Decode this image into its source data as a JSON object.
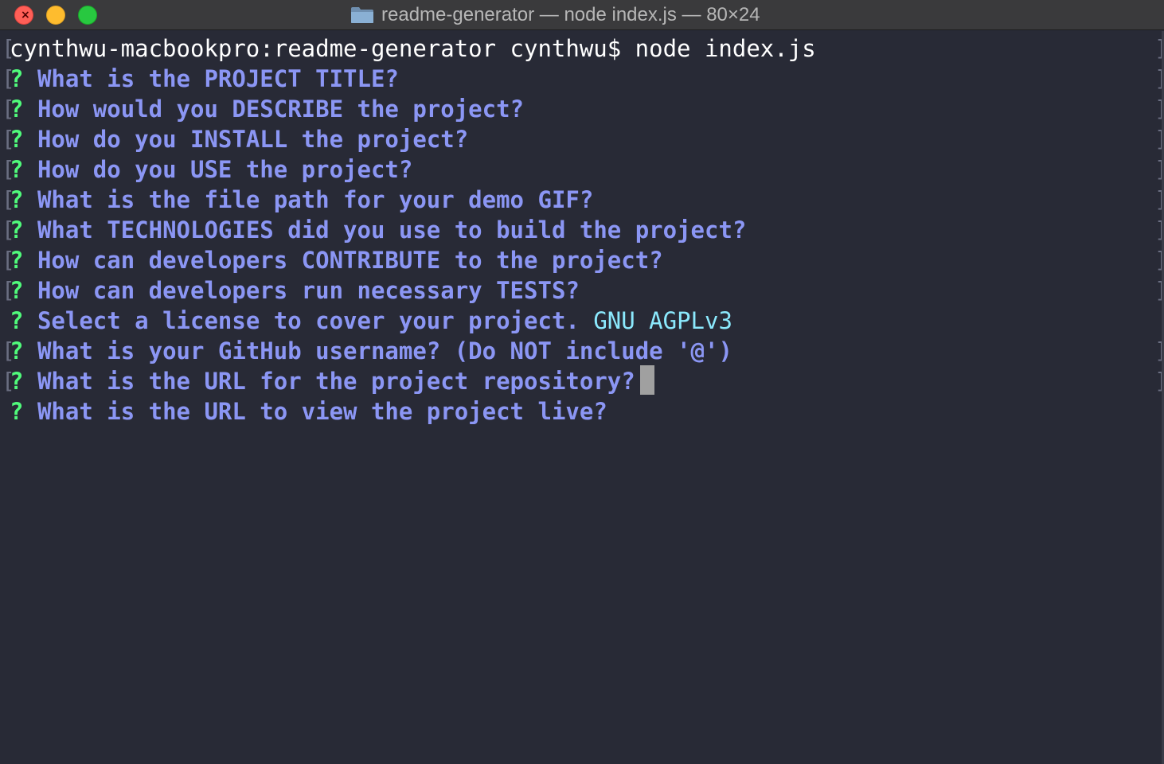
{
  "window": {
    "title": "readme-generator — node index.js — 80×24",
    "icon": "folder-icon",
    "controls": [
      "close",
      "minimize",
      "zoom"
    ]
  },
  "colors": {
    "background": "#282a36",
    "question_mark": "#50fa7b",
    "question_text": "#8b96f4",
    "answer_text": "#8be9fd",
    "prompt_text": "#ffffff",
    "cursor": "#a0a0a0"
  },
  "terminal": {
    "prompt": "cynthwu-macbookpro:readme-generator cynthwu$ node index.js",
    "questions": [
      {
        "mark": "?",
        "text": "What is the PROJECT TITLE?",
        "answer": ""
      },
      {
        "mark": "?",
        "text": "How would you DESCRIBE the project?",
        "answer": ""
      },
      {
        "mark": "?",
        "text": "How do you INSTALL the project?",
        "answer": ""
      },
      {
        "mark": "?",
        "text": "How do you USE the project?",
        "answer": ""
      },
      {
        "mark": "?",
        "text": "What is the file path for your demo GIF?",
        "answer": ""
      },
      {
        "mark": "?",
        "text": "What TECHNOLOGIES did you use to build the project?",
        "answer": ""
      },
      {
        "mark": "?",
        "text": "How can developers CONTRIBUTE to the project?",
        "answer": ""
      },
      {
        "mark": "?",
        "text": "How can developers run necessary TESTS?",
        "answer": ""
      },
      {
        "mark": "?",
        "text": "Select a license to cover your project.",
        "answer": "GNU AGPLv3"
      },
      {
        "mark": "?",
        "text": "What is your GitHub username? (Do NOT include '@')",
        "answer": ""
      },
      {
        "mark": "?",
        "text": "What is the URL for the project repository?",
        "answer": ""
      },
      {
        "mark": "?",
        "text": "What is the URL to view the project live?",
        "answer": ""
      }
    ]
  }
}
